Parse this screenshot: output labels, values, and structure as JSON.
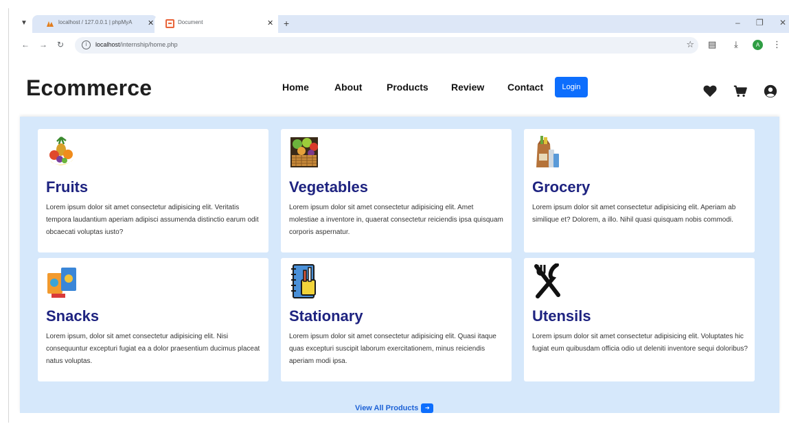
{
  "browser": {
    "tabs": [
      {
        "title": "localhost / 127.0.0.1 | phpMyA"
      },
      {
        "title": "Document"
      }
    ],
    "url_host": "localhost",
    "url_path": "/internship/home.php",
    "profile_initial": "A"
  },
  "header": {
    "brand": "Ecommerce",
    "nav": [
      {
        "label": "Home"
      },
      {
        "label": "About"
      },
      {
        "label": "Products"
      },
      {
        "label": "Review"
      },
      {
        "label": "Contact"
      }
    ],
    "login_label": "Login"
  },
  "cards": [
    {
      "title": "Fruits",
      "desc": "Lorem ipsum dolor sit amet consectetur adipisicing elit. Veritatis tempora laudantium aperiam adipisci assumenda distinctio earum odit obcaecati voluptas iusto?",
      "icon": "fruits-icon"
    },
    {
      "title": "Vegetables",
      "desc": "Lorem ipsum dolor sit amet consectetur adipisicing elit. Amet molestiae a inventore in, quaerat consectetur reiciendis ipsa quisquam corporis aspernatur.",
      "icon": "vegetables-icon"
    },
    {
      "title": "Grocery",
      "desc": "Lorem ipsum dolor sit amet consectetur adipisicing elit. Aperiam ab similique et? Dolorem, a illo. Nihil quasi quisquam nobis commodi.",
      "icon": "grocery-icon"
    },
    {
      "title": "Snacks",
      "desc": "Lorem ipsum, dolor sit amet consectetur adipisicing elit. Nisi consequuntur excepturi fugiat ea a dolor praesentium ducimus placeat natus voluptas.",
      "icon": "snacks-icon"
    },
    {
      "title": "Stationary",
      "desc": "Lorem ipsum dolor sit amet consectetur adipisicing elit. Quasi itaque quas excepturi suscipit laborum exercitationem, minus reiciendis aperiam modi ipsa.",
      "icon": "stationary-icon"
    },
    {
      "title": "Utensils",
      "desc": "Lorem ipsum dolor sit amet consectetur adipisicing elit. Voluptates hic fugiat eum quibusdam officia odio ut deleniti inventore sequi doloribus?",
      "icon": "utensils-icon"
    }
  ],
  "view_all_label": "View All Products",
  "colors": {
    "accent": "#0d6efd",
    "section_bg": "#d6e8fb",
    "card_title": "#1e2380"
  }
}
